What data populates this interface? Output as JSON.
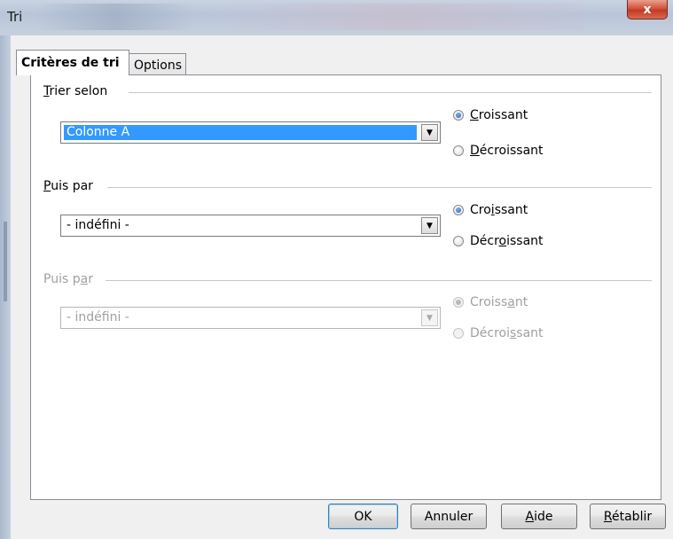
{
  "window": {
    "title": "Tri",
    "close_label": "x"
  },
  "tabs": [
    {
      "label": "Critères de tri",
      "active": true
    },
    {
      "label": "Options",
      "active": false
    }
  ],
  "groups": [
    {
      "label_prefix": "",
      "label_accel": "T",
      "label_suffix": "rier selon",
      "combo_value": "Colonne A",
      "combo_selected": true,
      "enabled": true,
      "radio_asc": {
        "pre": "",
        "accel": "C",
        "post": "roissant",
        "checked": true
      },
      "radio_desc": {
        "pre": "",
        "accel": "D",
        "post": "écroissant",
        "checked": false
      }
    },
    {
      "label_prefix": "",
      "label_accel": "P",
      "label_suffix": "uis par",
      "combo_value": "- indéfini -",
      "combo_selected": false,
      "enabled": true,
      "radio_asc": {
        "pre": "Cro",
        "accel": "i",
        "post": "ssant",
        "checked": true
      },
      "radio_desc": {
        "pre": "Décr",
        "accel": "o",
        "post": "issant",
        "checked": false
      }
    },
    {
      "label_prefix": "Puis p",
      "label_accel": "a",
      "label_suffix": "r",
      "combo_value": "- indéfini -",
      "combo_selected": false,
      "enabled": false,
      "radio_asc": {
        "pre": "Croiss",
        "accel": "a",
        "post": "nt",
        "checked": true
      },
      "radio_desc": {
        "pre": "Décroi",
        "accel": "s",
        "post": "sant",
        "checked": false
      }
    }
  ],
  "buttons": {
    "ok": "OK",
    "cancel": "Annuler",
    "help_accel": "A",
    "help_rest": "ide",
    "reset_accel": "R",
    "reset_rest": "établir"
  }
}
